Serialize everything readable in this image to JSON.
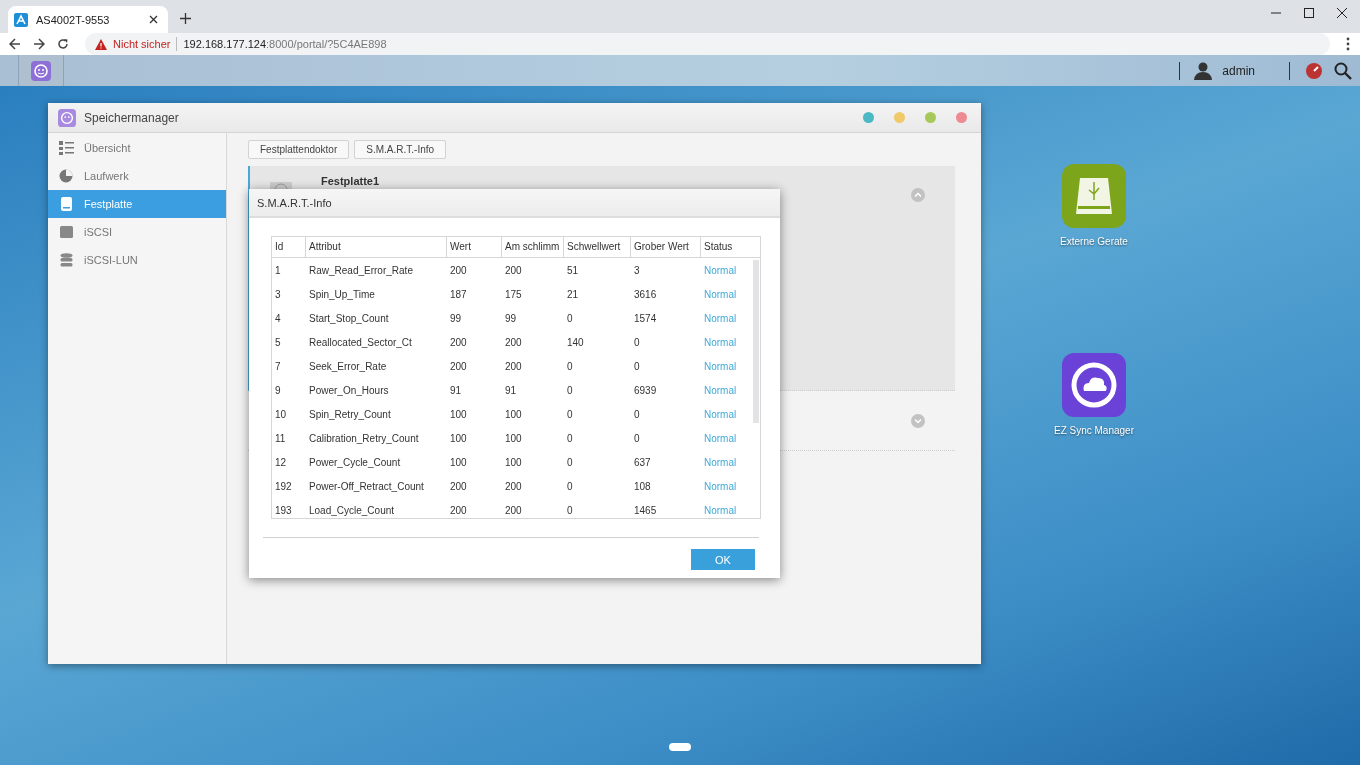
{
  "browser": {
    "tab": {
      "title": "AS4002T-9553"
    },
    "address": {
      "warning": "Nicht sicher",
      "host": "192.168.177.124",
      "path": ":8000/portal/?5C4AE898"
    }
  },
  "topbar": {
    "user": "admin"
  },
  "window": {
    "title": "Speichermanager",
    "sidebar": [
      {
        "label": "Übersicht",
        "selected": false
      },
      {
        "label": "Laufwerk",
        "selected": false
      },
      {
        "label": "Festplatte",
        "selected": true
      },
      {
        "label": "iSCSI",
        "selected": false
      },
      {
        "label": "iSCSI-LUN",
        "selected": false
      }
    ],
    "toolbar": [
      "Festplattendoktor",
      "S.M.A.R.T.-Info"
    ],
    "disk": {
      "name": "Festplatte1"
    }
  },
  "dialog": {
    "title": "S.M.A.R.T.-Info",
    "columns": [
      "Id",
      "Attribut",
      "Wert",
      "Am schlimm",
      "Schwellwert",
      "Grober Wert",
      "Status"
    ],
    "rows": [
      [
        "1",
        "Raw_Read_Error_Rate",
        "200",
        "200",
        "51",
        "3",
        "Normal"
      ],
      [
        "3",
        "Spin_Up_Time",
        "187",
        "175",
        "21",
        "3616",
        "Normal"
      ],
      [
        "4",
        "Start_Stop_Count",
        "99",
        "99",
        "0",
        "1574",
        "Normal"
      ],
      [
        "5",
        "Reallocated_Sector_Ct",
        "200",
        "200",
        "140",
        "0",
        "Normal"
      ],
      [
        "7",
        "Seek_Error_Rate",
        "200",
        "200",
        "0",
        "0",
        "Normal"
      ],
      [
        "9",
        "Power_On_Hours",
        "91",
        "91",
        "0",
        "6939",
        "Normal"
      ],
      [
        "10",
        "Spin_Retry_Count",
        "100",
        "100",
        "0",
        "0",
        "Normal"
      ],
      [
        "11",
        "Calibration_Retry_Count",
        "100",
        "100",
        "0",
        "0",
        "Normal"
      ],
      [
        "12",
        "Power_Cycle_Count",
        "100",
        "100",
        "0",
        "637",
        "Normal"
      ],
      [
        "192",
        "Power-Off_Retract_Count",
        "200",
        "200",
        "0",
        "108",
        "Normal"
      ],
      [
        "193",
        "Load_Cycle_Count",
        "200",
        "200",
        "0",
        "1465",
        "Normal"
      ]
    ],
    "ok": "OK"
  },
  "desktop_icons": [
    {
      "label": "Externe Gerate"
    },
    {
      "label": "EZ Sync Manager"
    }
  ]
}
